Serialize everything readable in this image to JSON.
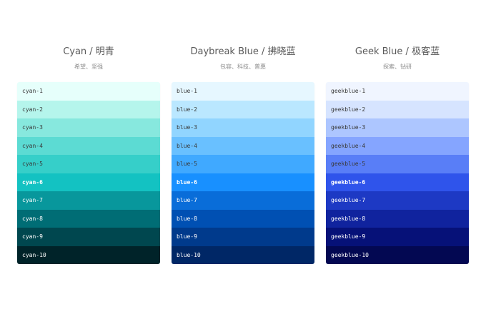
{
  "palettes": [
    {
      "title": "Cyan / 明青",
      "description": "希望、坚强",
      "swatches": [
        {
          "name": "cyan-1",
          "color": "#e6fffb",
          "text": "#3a3a3a"
        },
        {
          "name": "cyan-2",
          "color": "#b5f5ec",
          "text": "#3a3a3a"
        },
        {
          "name": "cyan-3",
          "color": "#87e8de",
          "text": "#3a3a3a"
        },
        {
          "name": "cyan-4",
          "color": "#5cdbd3",
          "text": "#3a3a3a"
        },
        {
          "name": "cyan-5",
          "color": "#36cfc9",
          "text": "#3a3a3a"
        },
        {
          "name": "cyan-6",
          "color": "#13c2c2",
          "text": "#ffffff"
        },
        {
          "name": "cyan-7",
          "color": "#08979c",
          "text": "#ffffff"
        },
        {
          "name": "cyan-8",
          "color": "#006d75",
          "text": "#ffffff"
        },
        {
          "name": "cyan-9",
          "color": "#00474f",
          "text": "#ffffff"
        },
        {
          "name": "cyan-10",
          "color": "#002329",
          "text": "#ffffff"
        }
      ]
    },
    {
      "title": "Daybreak Blue / 拂晓蓝",
      "description": "包容、科技、普惠",
      "swatches": [
        {
          "name": "blue-1",
          "color": "#e6f7ff",
          "text": "#3a3a3a"
        },
        {
          "name": "blue-2",
          "color": "#bae7ff",
          "text": "#3a3a3a"
        },
        {
          "name": "blue-3",
          "color": "#91d5ff",
          "text": "#3a3a3a"
        },
        {
          "name": "blue-4",
          "color": "#69c0ff",
          "text": "#3a3a3a"
        },
        {
          "name": "blue-5",
          "color": "#40a9ff",
          "text": "#3a3a3a"
        },
        {
          "name": "blue-6",
          "color": "#1890ff",
          "text": "#ffffff"
        },
        {
          "name": "blue-7",
          "color": "#096dd9",
          "text": "#ffffff"
        },
        {
          "name": "blue-8",
          "color": "#0050b3",
          "text": "#ffffff"
        },
        {
          "name": "blue-9",
          "color": "#003a8c",
          "text": "#ffffff"
        },
        {
          "name": "blue-10",
          "color": "#002766",
          "text": "#ffffff"
        }
      ]
    },
    {
      "title": "Geek Blue / 极客蓝",
      "description": "探索、钻研",
      "swatches": [
        {
          "name": "geekblue-1",
          "color": "#f0f5ff",
          "text": "#3a3a3a"
        },
        {
          "name": "geekblue-2",
          "color": "#d6e4ff",
          "text": "#3a3a3a"
        },
        {
          "name": "geekblue-3",
          "color": "#adc6ff",
          "text": "#3a3a3a"
        },
        {
          "name": "geekblue-4",
          "color": "#85a5ff",
          "text": "#3a3a3a"
        },
        {
          "name": "geekblue-5",
          "color": "#597ef7",
          "text": "#3a3a3a"
        },
        {
          "name": "geekblue-6",
          "color": "#2f54eb",
          "text": "#ffffff"
        },
        {
          "name": "geekblue-7",
          "color": "#1d39c4",
          "text": "#ffffff"
        },
        {
          "name": "geekblue-8",
          "color": "#10239e",
          "text": "#ffffff"
        },
        {
          "name": "geekblue-9",
          "color": "#061178",
          "text": "#ffffff"
        },
        {
          "name": "geekblue-10",
          "color": "#030852",
          "text": "#ffffff"
        }
      ]
    }
  ]
}
